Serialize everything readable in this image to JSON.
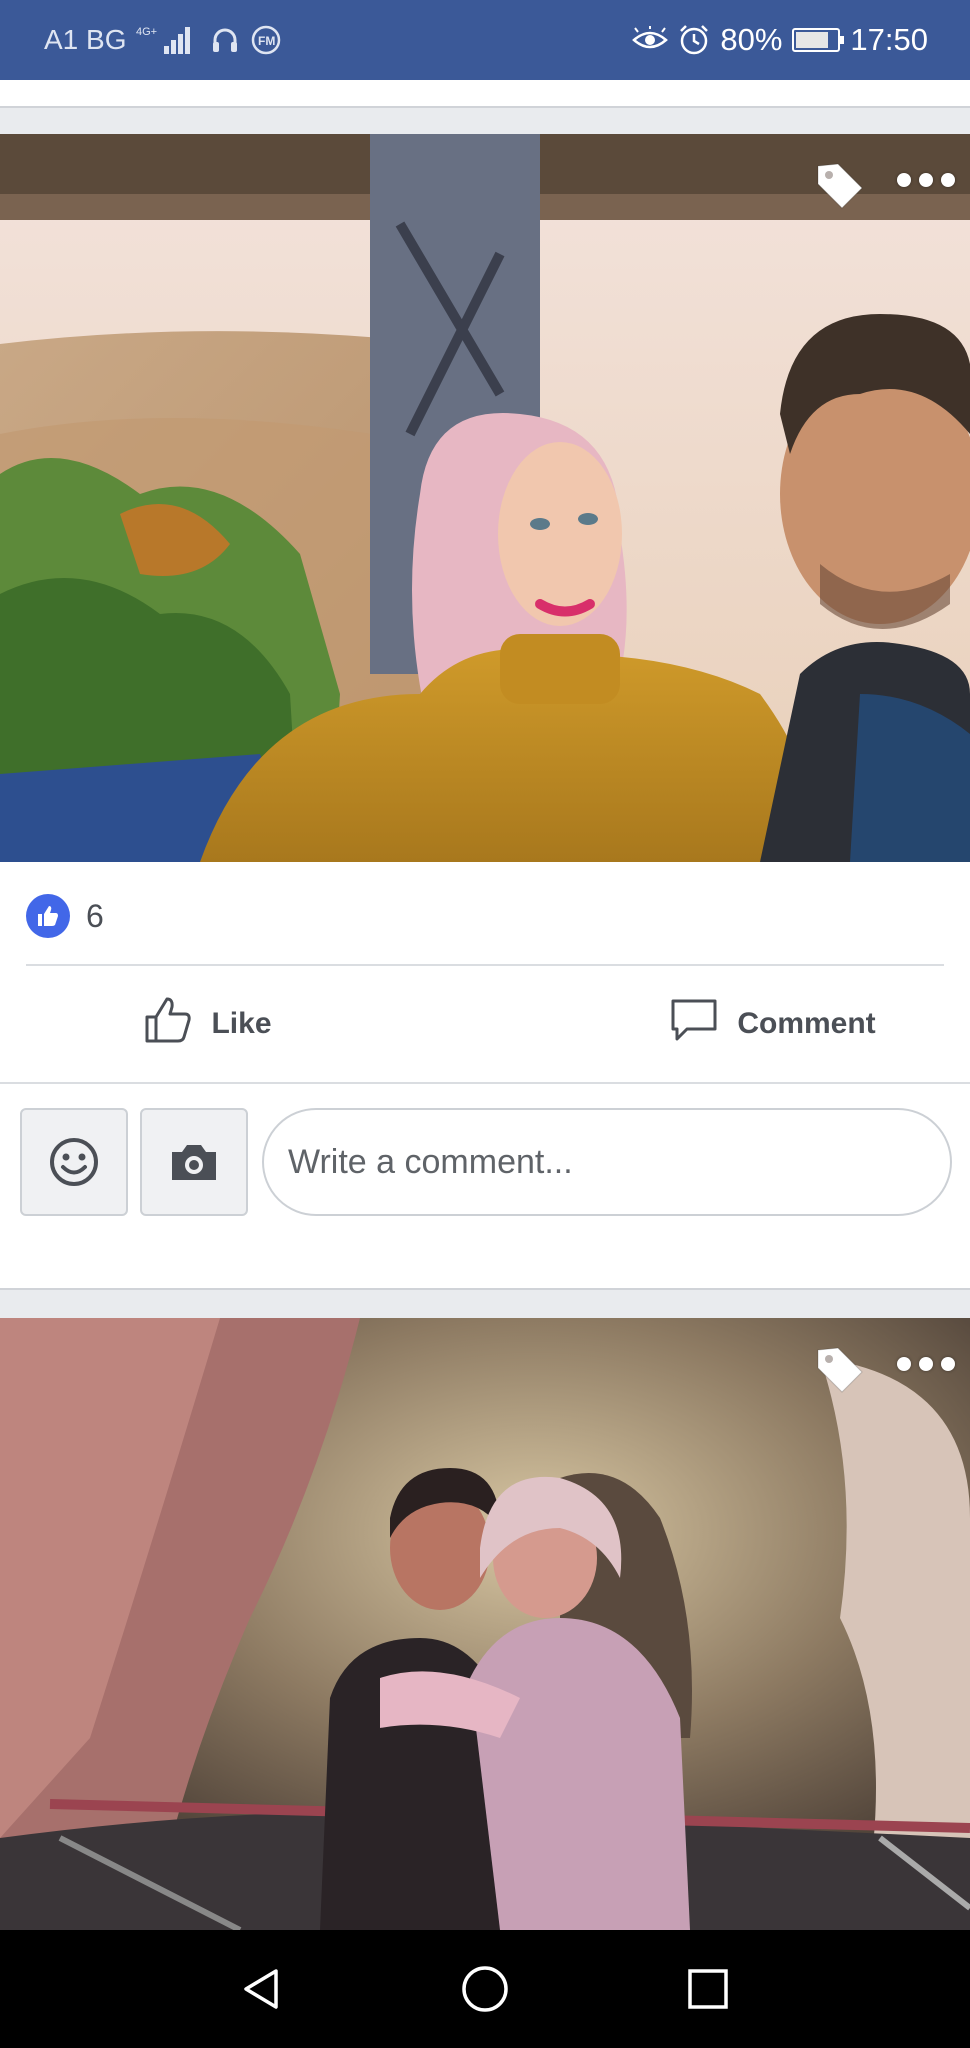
{
  "status_bar": {
    "carrier": "A1 BG",
    "network": "4G+",
    "battery": "80%",
    "battery_level": 0.8,
    "time": "17:50"
  },
  "post": {
    "reaction_count": "6",
    "like_label": "Like",
    "comment_label": "Comment",
    "comment_placeholder": "Write a comment..."
  },
  "icons": {
    "status_left": [
      "signal-icon",
      "headphones-icon",
      "fm-radio-icon"
    ],
    "status_right": [
      "eye-icon",
      "alarm-icon",
      "battery-icon"
    ],
    "photo_overlay": [
      "tag-icon",
      "more-options-icon"
    ],
    "nav": [
      "back-icon",
      "home-icon",
      "recents-icon"
    ]
  },
  "colors": {
    "status_bar": "#3b5998",
    "like_badge": "#4267e8",
    "text_secondary": "#4b4f56"
  }
}
